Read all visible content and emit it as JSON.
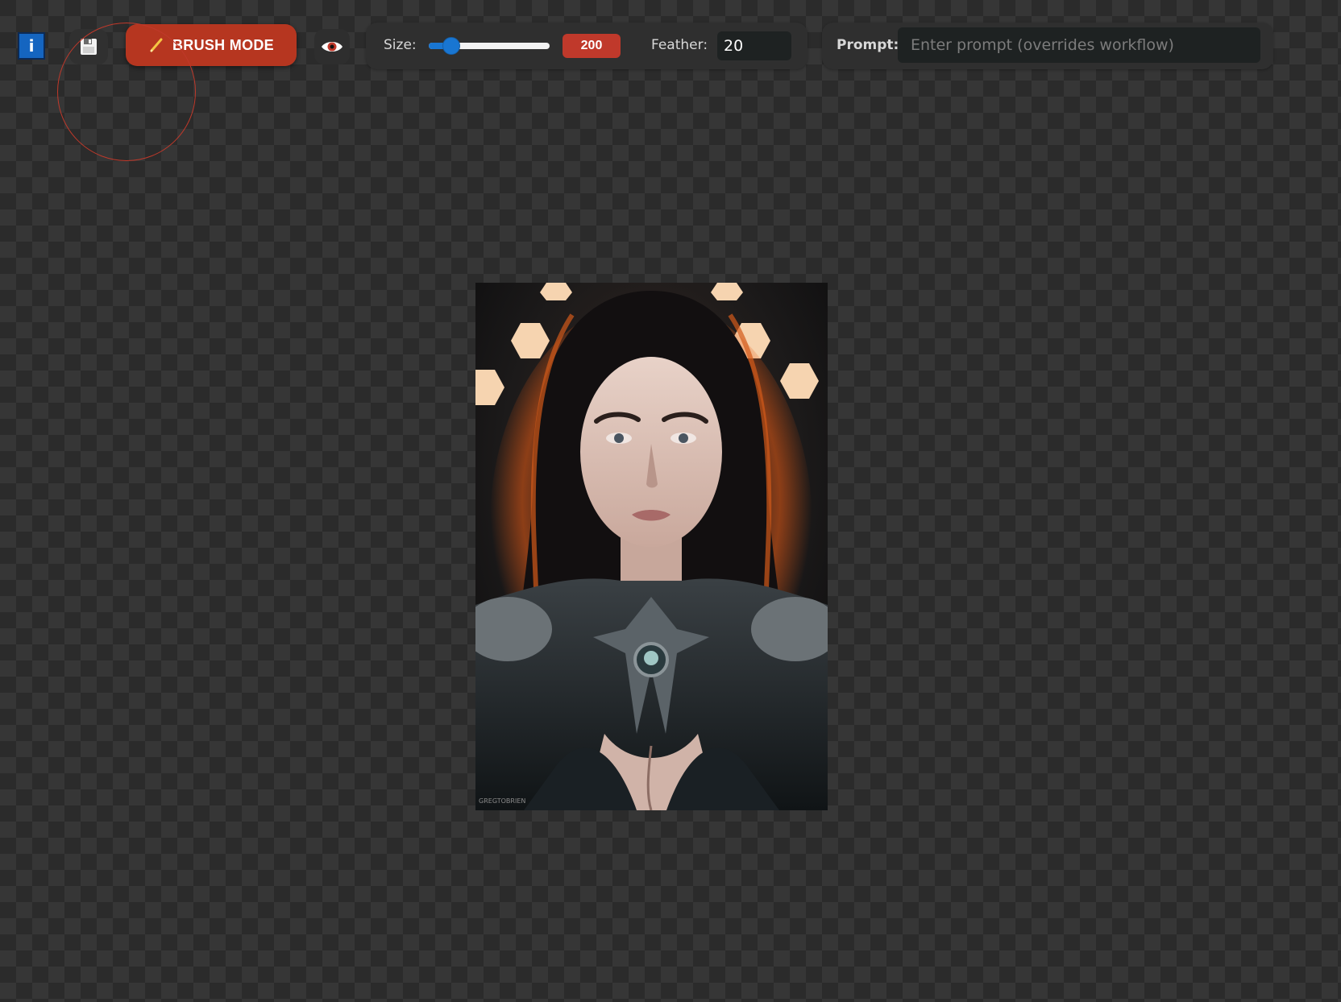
{
  "toolbar": {
    "info_label": "i",
    "brush_mode_label": "BRUSH MODE",
    "size_label": "Size:",
    "size_value": "200",
    "size_fraction": 0.13,
    "feather_label": "Feather:",
    "feather_value": "20",
    "prompt_label": "Prompt:",
    "prompt_placeholder": "Enter prompt (overrides workflow)",
    "prompt_value": ""
  },
  "icons": {
    "info": "info-icon",
    "save": "floppy-disk-icon",
    "brush": "pencil-icon",
    "preview": "eye-icon"
  },
  "colors": {
    "accent": "#c0392b",
    "brush_button": "#b63620",
    "slider": "#1976d2",
    "info_button": "#1565c0"
  },
  "canvas": {
    "image_watermark": "GREGTOBRIEN"
  }
}
